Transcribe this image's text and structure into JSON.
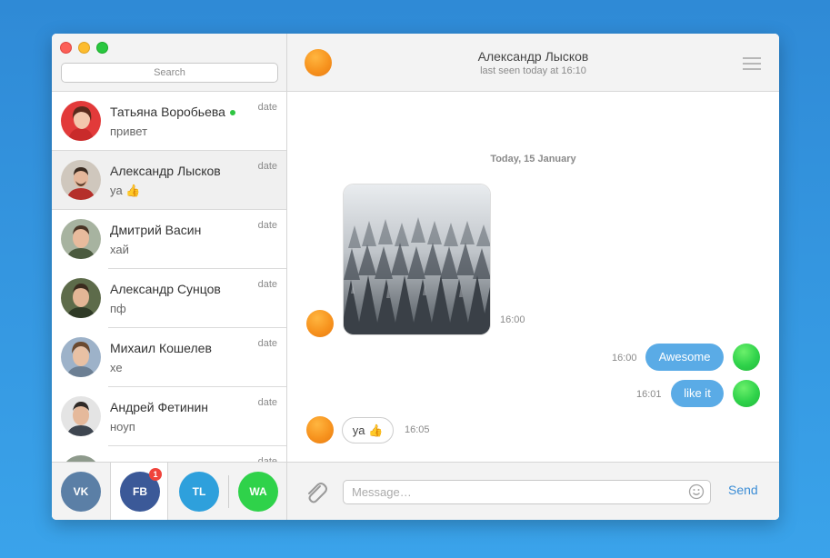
{
  "sidebar": {
    "search_placeholder": "Search",
    "contacts": [
      {
        "name": "Татьяна Воробьева",
        "message": "привет",
        "date": "date",
        "online": true
      },
      {
        "name": "Александр Лысков",
        "message": "ya 👍",
        "date": "date",
        "active": true
      },
      {
        "name": "Дмитрий Васин",
        "message": "хай",
        "date": "date"
      },
      {
        "name": "Александр Сунцов",
        "message": "пф",
        "date": "date"
      },
      {
        "name": "Михаил Кошелев",
        "message": "хе",
        "date": "date"
      },
      {
        "name": "Андрей Фетинин",
        "message": "ноуп",
        "date": "date"
      },
      {
        "name": "",
        "message": "",
        "date": "date"
      }
    ],
    "networks": [
      {
        "label": "VK",
        "color": "#5b7fa6"
      },
      {
        "label": "FB",
        "color": "#3b5998",
        "badge": "1",
        "active": true
      },
      {
        "label": "TL",
        "color": "#2ea0dc"
      },
      {
        "label": "WA",
        "color": "#2fd24a"
      }
    ]
  },
  "chat": {
    "header": {
      "name": "Александр Лысков",
      "status": "last seen today at 16:10"
    },
    "day_label": "Today, 15 January",
    "messages": [
      {
        "type": "photo",
        "direction": "in",
        "time": "16:00"
      },
      {
        "type": "text",
        "direction": "out",
        "text": "Awesome",
        "time": "16:00"
      },
      {
        "type": "text",
        "direction": "out",
        "text": "like it",
        "time": "16:01"
      },
      {
        "type": "text",
        "direction": "in",
        "text": "ya 👍",
        "time": "16:05"
      }
    ],
    "input": {
      "placeholder": "Message…",
      "send_label": "Send"
    }
  },
  "icons": {
    "menu": "hamburger-menu-icon",
    "attach": "paperclip-icon",
    "emoji": "smiley-icon"
  },
  "colors": {
    "accent": "#5aabe6",
    "send": "#3d8ed6",
    "online": "#2fc542",
    "badge": "#f0433b"
  }
}
